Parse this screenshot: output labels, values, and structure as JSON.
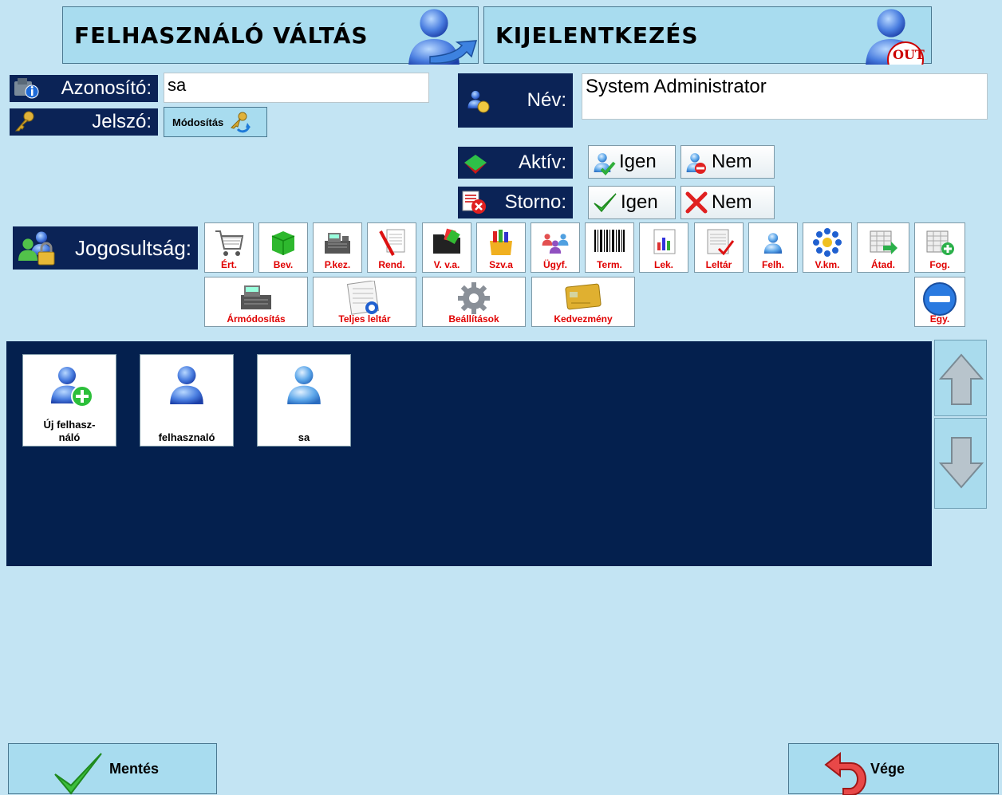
{
  "header": {
    "switch_user_label": "FELHASZNÁLÓ VÁLTÁS",
    "logout_label": "KIJELENTKEZÉS",
    "logout_badge": "OUT"
  },
  "form": {
    "id_label": "Azonosító:",
    "id_value": "sa",
    "password_label": "Jelszó:",
    "password_modify_label": "Módosítás",
    "name_label": "Név:",
    "name_value": "System Administrator",
    "active_label": "Aktív:",
    "active_yes": "Igen",
    "active_no": "Nem",
    "storno_label": "Storno:",
    "storno_yes": "Igen",
    "storno_no": "Nem",
    "permissions_label": "Jogosultság:"
  },
  "permissions_row1": [
    "Ért.",
    "Bev.",
    "P.kez.",
    "Rend.",
    "V. v.a.",
    "Szv.a",
    "Ügyf.",
    "Term.",
    "Lek.",
    "Leltár",
    "Felh.",
    "V.km.",
    "Átad.",
    "Fog."
  ],
  "permissions_row2": [
    "Ármódosítás",
    "Teljes leltár",
    "Beállítások",
    "Kedvezmény",
    "Egy."
  ],
  "users": [
    "Új felhasz-\nnáló",
    "felhasznaló",
    "sa"
  ],
  "footer": {
    "save_label": "Mentés",
    "exit_label": "Vége"
  },
  "colors": {
    "background": "#c3e4f3",
    "navy": "#0b2356",
    "button": "#a8dcef",
    "perm_label": "#e00000"
  }
}
